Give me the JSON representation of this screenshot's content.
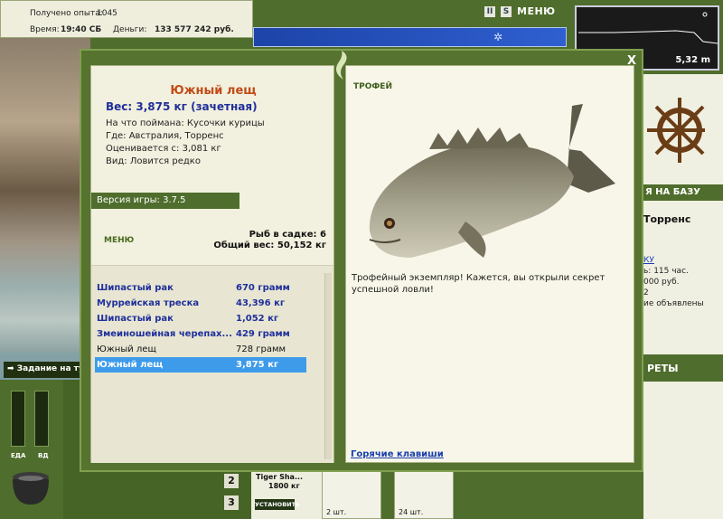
{
  "hud": {
    "exp_label": "Получено опыта:",
    "exp_value": "1045",
    "time_label": "Время:",
    "time_value": "19:40 СБ",
    "money_label": "Деньги:",
    "money_value": "133 577 242 руб."
  },
  "top_icons": {
    "pause": "II",
    "sound": "S",
    "menu": "МЕНЮ"
  },
  "depth": {
    "value": "5,32 m"
  },
  "dialog": {
    "close": "X",
    "fish": {
      "title": "Южный лещ",
      "weight": "Вес: 3,875 кг (зачетная)",
      "bait": "На что поймана: Кусочки курицы",
      "where": "Где: Австралия, Торренс",
      "valued_from": "Оценивается с: 3,081 кг",
      "type": "Вид: Ловится редко"
    },
    "version": "Версия игры: 3.7.5",
    "menu": "МЕНЮ",
    "keepnet": {
      "count": "Рыб в садке: 6",
      "total": "Общий вес: 50,152 кг"
    },
    "catch_list": [
      {
        "name": "Шипастый рак",
        "weight": "670 грамм",
        "style": "bold"
      },
      {
        "name": "Муррейская треска",
        "weight": "43,396 кг",
        "style": "bold"
      },
      {
        "name": "Шипастый рак",
        "weight": "1,052 кг",
        "style": "bold"
      },
      {
        "name": "Змеиношейная черепах...",
        "weight": "429 грамм",
        "style": "bold"
      },
      {
        "name": "Южный лещ",
        "weight": "728 грамм",
        "style": "plain"
      },
      {
        "name": "Южный лещ",
        "weight": "3,875 кг",
        "style": "sel"
      }
    ],
    "trophy": {
      "label": "ТРОФЕЙ",
      "text": "Трофейный экземпляр! Кажется, вы открыли секрет успешной ловли!"
    },
    "hotkeys": "Горячие клавиши"
  },
  "side": {
    "to_base": "Я НА БАЗУ",
    "location": "Торренс",
    "link": "КУ",
    "line1": "ь: 115 час.",
    "line2": "000 руб.",
    "line3": "2",
    "line4": "ие объявлены",
    "rety": "РЕТЫ"
  },
  "task": "Задание на тур",
  "bottom": {
    "eda": "ЕДА",
    "vd": "ВД",
    "slot2": "2",
    "slot3": "3",
    "tackle_name": "Tiger Sha...",
    "tackle_weight": "1800 кг",
    "install": "УСТАНОВИТЬ",
    "count1": "2 шт.",
    "count2": "24 шт."
  }
}
